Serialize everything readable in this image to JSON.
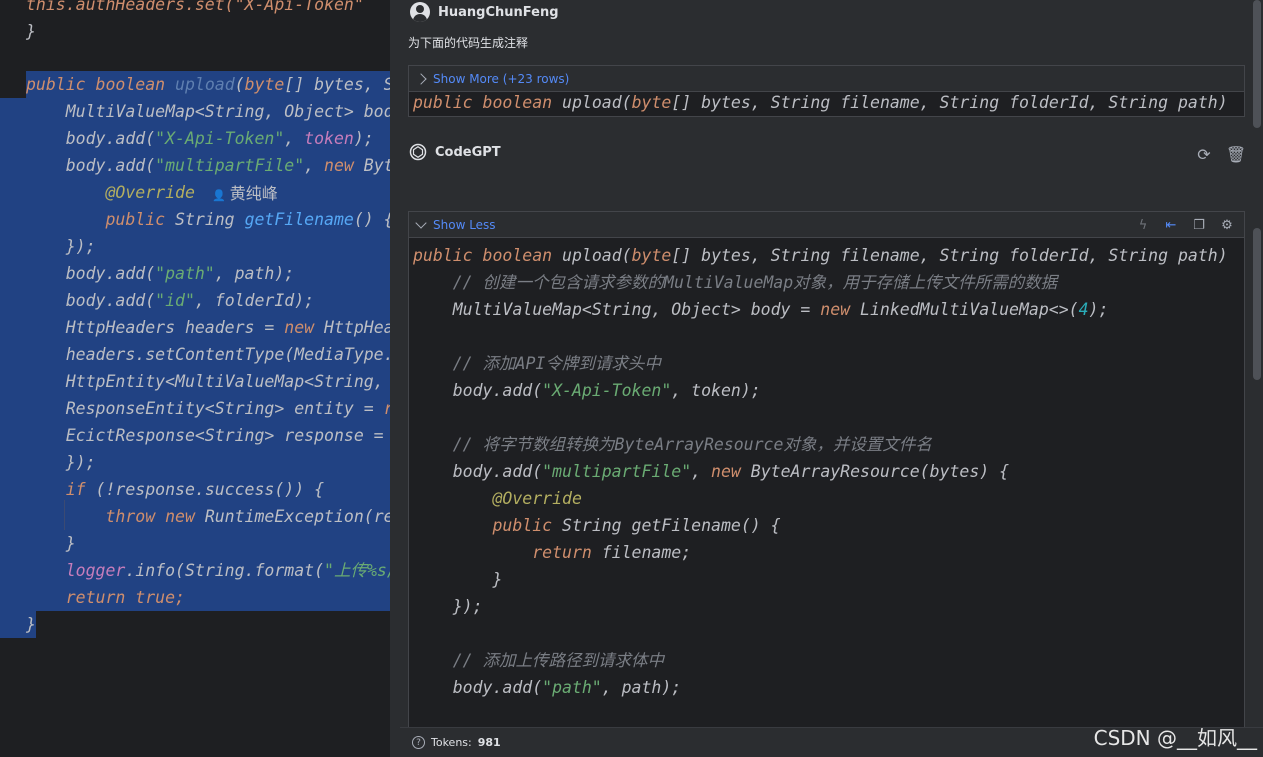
{
  "editor": {
    "line0": "this.authHeaders.set(\"X-Api-Token\"",
    "line1": "}",
    "line3": {
      "a": "public ",
      "b": "boolean ",
      "c": "upload",
      "d": "(",
      "e": "byte",
      "f": "[] bytes, St"
    },
    "line4": "    MultiValueMap<String, Object> body",
    "line5": {
      "a": "    body.add(",
      "b": "\"X-Api-Token\"",
      "c": ", ",
      "d": "token",
      "e": ");"
    },
    "line6": {
      "a": "    body.add(",
      "b": "\"multipartFile\"",
      "c": ", ",
      "d": "new ",
      "e": "Byte"
    },
    "line7": "        @Override",
    "line7_hint": "黄纯峰",
    "line8": {
      "a": "        public ",
      "b": "String ",
      "c": "getFilename",
      "d": "() {"
    },
    "line9": "    });",
    "line10": {
      "a": "    body.add(",
      "b": "\"path\"",
      "c": ", path);"
    },
    "line11": {
      "a": "    body.add(",
      "b": "\"id\"",
      "c": ", folderId);"
    },
    "line12": {
      "a": "    HttpHeaders headers = ",
      "b": "new ",
      "c": "HttpHead"
    },
    "line13": "    headers.setContentType(MediaType.M",
    "line14": "    HttpEntity<MultiValueMap<String, O",
    "line15": {
      "a": "    ResponseEntity<String> entity = ",
      "b": "re"
    },
    "line16": {
      "a": "    EcictResponse<String> response = ",
      "b": "e"
    },
    "line17": "    });",
    "line18": {
      "a": "    if ",
      "b": "(!response.success()) {"
    },
    "line19": {
      "a": "        throw new ",
      "b": "RuntimeException(res"
    },
    "line20": "    }",
    "line21": {
      "a": "    logger",
      "b": ".info(String.format(",
      "c": "\"上传%s/"
    },
    "line22": {
      "a": "    return ",
      "b": "true;"
    },
    "line23": "}"
  },
  "chat": {
    "user_name": "HuangChunFeng",
    "prompt": "为下面的代码生成注释",
    "show_more": "Show More (+23 rows)",
    "bot_name": "CodeGPT",
    "show_less": "Show Less",
    "signature": {
      "a": "public ",
      "b": "boolean ",
      "c": "upload",
      "d": "(",
      "e": "byte",
      "f": "[] bytes, String filename, String folderId, String path)"
    },
    "response_lines": {
      "r1": "    // 创建一个包含请求参数的MultiValueMap对象，用于存储上传文件所需的数据",
      "r2": {
        "a": "    MultiValueMap<String, Object> body = ",
        "b": "new ",
        "c": "LinkedMultiValueMap<>(",
        "d": "4",
        "e": ");"
      },
      "r4": "    // 添加API令牌到请求头中",
      "r5": {
        "a": "    body.add(",
        "b": "\"X-Api-Token\"",
        "c": ", token);"
      },
      "r7": "    // 将字节数组转换为ByteArrayResource对象，并设置文件名",
      "r8": {
        "a": "    body.add(",
        "b": "\"multipartFile\"",
        "c": ", ",
        "d": "new ",
        "e": "ByteArrayResource(bytes) {"
      },
      "r9": "        @Override",
      "r10": {
        "a": "        public ",
        "b": "String getFilename() {"
      },
      "r11": {
        "a": "            return ",
        "b": "filename;"
      },
      "r12": "        }",
      "r13": "    });",
      "r15": "    // 添加上传路径到请求体中",
      "r16": {
        "a": "    body.add(",
        "b": "\"path\"",
        "c": ", path);"
      }
    },
    "tokens_label": "Tokens:",
    "tokens_value": "981"
  },
  "watermark": "CSDN @__如风__",
  "icons": [
    "user-avatar-icon",
    "chevron-right-icon",
    "chevron-down-icon",
    "openai-logo-icon",
    "refresh-icon",
    "trash-icon",
    "lightning-icon",
    "insert-left-icon",
    "copy-icon",
    "settings-icon",
    "help-icon"
  ],
  "colors": {
    "selection": "#214283",
    "keyword": "#cf8e6d",
    "function": "#56a8f5",
    "string": "#6aab73",
    "comment": "#7a7e85",
    "link": "#548af7"
  }
}
